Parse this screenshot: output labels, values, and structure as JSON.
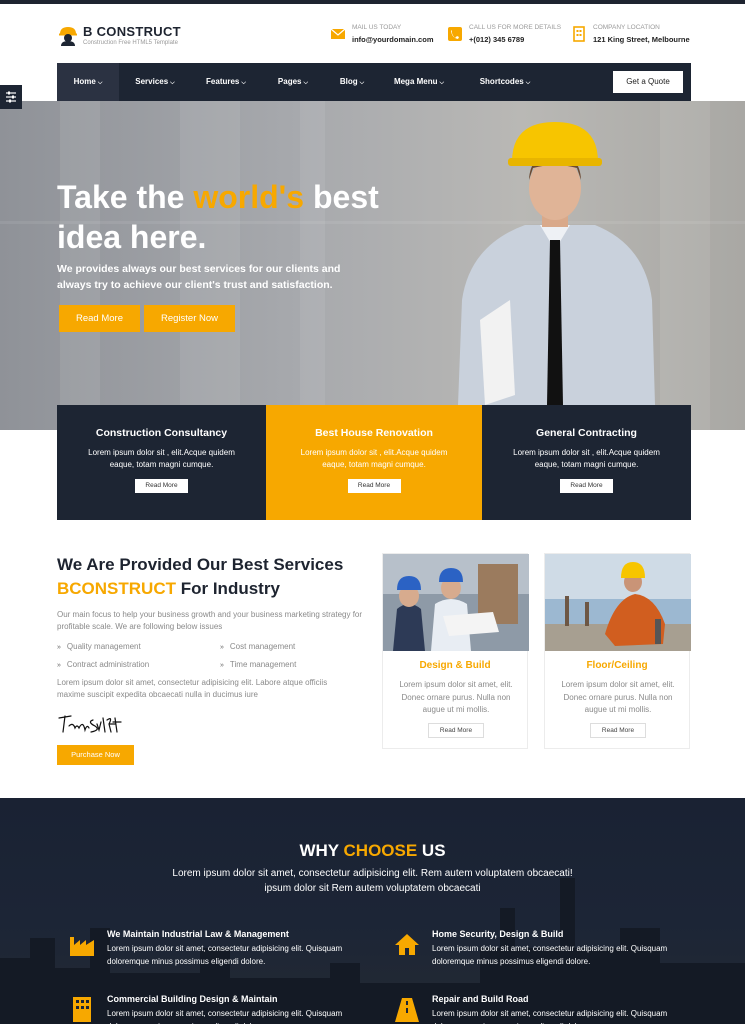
{
  "brand": {
    "name": "B CONSTRUCT",
    "tagline": "Construction Free HTML5 Template",
    "accent": "#f7a800",
    "dark": "#1d2533"
  },
  "header_info": [
    {
      "icon": "mail-icon",
      "label": "MAIL US TODAY",
      "value": "info@yourdomain.com"
    },
    {
      "icon": "phone-icon",
      "label": "CALL US FOR MORE DETAILS",
      "value": "+(012) 345 6789"
    },
    {
      "icon": "building-icon",
      "label": "COMPANY LOCATION",
      "value": "121 King Street, Melbourne"
    }
  ],
  "nav": {
    "items": [
      "Home",
      "Services",
      "Features",
      "Pages",
      "Blog",
      "Mega Menu",
      "Shortcodes"
    ],
    "quote_label": "Get a Quote"
  },
  "hero": {
    "title_pre": "Take the ",
    "title_hl": "world's",
    "title_post": " best idea here.",
    "subtitle": "We provides always our best services for our clients and always try to achieve our client's trust and satisfaction.",
    "btn_read": "Read More",
    "btn_register": "Register Now"
  },
  "features": [
    {
      "title": "Construction Consultancy",
      "desc": "Lorem ipsum dolor sit , elit.Acque quidem eaque, totam magni cumque.",
      "btn": "Read More"
    },
    {
      "title": "Best House Renovation",
      "desc": "Lorem ipsum dolor sit , elit.Acque quidem eaque, totam magni cumque.",
      "btn": "Read More"
    },
    {
      "title": "General Contracting",
      "desc": "Lorem ipsum dolor sit , elit.Acque quidem eaque, totam magni cumque.",
      "btn": "Read More"
    }
  ],
  "about": {
    "title_line1": "We Are Provided Our Best Services",
    "title_hl": "BCONSTRUCT",
    "title_post": " For Industry",
    "desc": "Our main focus to help your business growth and your business marketing strategy for profitable scale. We are following below issues",
    "checks": [
      "Quality management",
      "Cost management",
      "Contract administration",
      "Time management"
    ],
    "desc2": "Lorem ipsum dolor sit amet, consectetur adipisicing elit. Labore atque officiis maxime suscipit expedita obcaecati nulla in ducimus iure",
    "signature": "Taylor Swift",
    "btn": "Purchase Now"
  },
  "services": [
    {
      "title": "Design & Build",
      "desc": "Lorem ipsum dolor sit amet, elit. Donec ornare purus. Nulla non augue ut mi mollis.",
      "btn": "Read More"
    },
    {
      "title": "Floor/Ceiling",
      "desc": "Lorem ipsum dolor sit amet, elit. Donec ornare purus. Nulla non augue ut mi mollis.",
      "btn": "Read More"
    }
  ],
  "why": {
    "title_pre": "WHY ",
    "title_hl": "CHOOSE",
    "title_post": " US",
    "subtitle": "Lorem ipsum dolor sit amet, consectetur adipisicing elit. Rem autem voluptatem obcaecati! ipsum dolor sit Rem autem voluptatem obcaecati",
    "items": [
      {
        "icon": "factory-icon",
        "title": "We Maintain Industrial Law & Management",
        "desc": "Lorem ipsum dolor sit amet, consectetur adipisicing elit. Quisquam doloremque minus possimus eligendi dolore."
      },
      {
        "icon": "home-icon",
        "title": "Home Security, Design & Build",
        "desc": "Lorem ipsum dolor sit amet, consectetur adipisicing elit. Quisquam doloremque minus possimus eligendi dolore."
      },
      {
        "icon": "building-icon",
        "title": "Commercial Building Design & Maintain",
        "desc": "Lorem ipsum dolor sit amet, consectetur adipisicing elit. Quisquam doloremque minus possimus eligendi dolore."
      },
      {
        "icon": "road-icon",
        "title": "Repair and Build Road",
        "desc": "Lorem ipsum dolor sit amet, consectetur adipisicing elit. Quisquam doloremque minus possimus eligendi dolore."
      }
    ]
  }
}
